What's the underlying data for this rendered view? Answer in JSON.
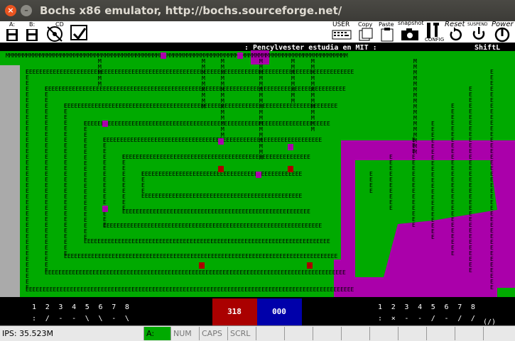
{
  "window": {
    "title": "Bochs x86 emulator, http://bochs.sourceforge.net/"
  },
  "toolbar": {
    "buttons": [
      {
        "id": "floppy-a",
        "label": "A:"
      },
      {
        "id": "floppy-b",
        "label": "B:"
      },
      {
        "id": "cdrom",
        "label": "CD"
      },
      {
        "id": "boot",
        "label": ""
      },
      {
        "id": "user",
        "label": "USER"
      },
      {
        "id": "copy",
        "label": "Copy"
      },
      {
        "id": "paste",
        "label": "Paste"
      },
      {
        "id": "snapshot",
        "label": "snapshot"
      },
      {
        "id": "config",
        "label": "CONFIG"
      },
      {
        "id": "reset",
        "label": "Reset"
      },
      {
        "id": "suspend",
        "label": "SUSPEND"
      },
      {
        "id": "power",
        "label": "Power"
      }
    ]
  },
  "game": {
    "top_message": ": Pencylvester estudia en MIT :",
    "shift_hint": "ShiftL",
    "colors": {
      "field": "#00aa00",
      "player2": "#aa00aa",
      "wall_left": "#aaaaaa",
      "player1_score_bg": "#aa0000",
      "player2_score_bg": "#0000aa"
    },
    "player1": {
      "score": "318",
      "numbers": [
        "1",
        "2",
        "3",
        "4",
        "5",
        "6",
        "7",
        "8"
      ],
      "arrows": [
        ":",
        "/",
        "-",
        "-",
        "\\",
        "\\",
        "-",
        "\\"
      ]
    },
    "player2": {
      "score": "000",
      "numbers": [
        "1",
        "2",
        "3",
        "4",
        "5",
        "6",
        "7",
        "8"
      ],
      "arrows": [
        ":",
        "×",
        "-",
        "-",
        "/",
        "-",
        "/",
        "/"
      ],
      "hint": "(/)"
    }
  },
  "status": {
    "ips": "IPS: 35.523M",
    "drive": "A:",
    "num": "NUM",
    "caps": "CAPS",
    "scrl": "SCRL"
  }
}
